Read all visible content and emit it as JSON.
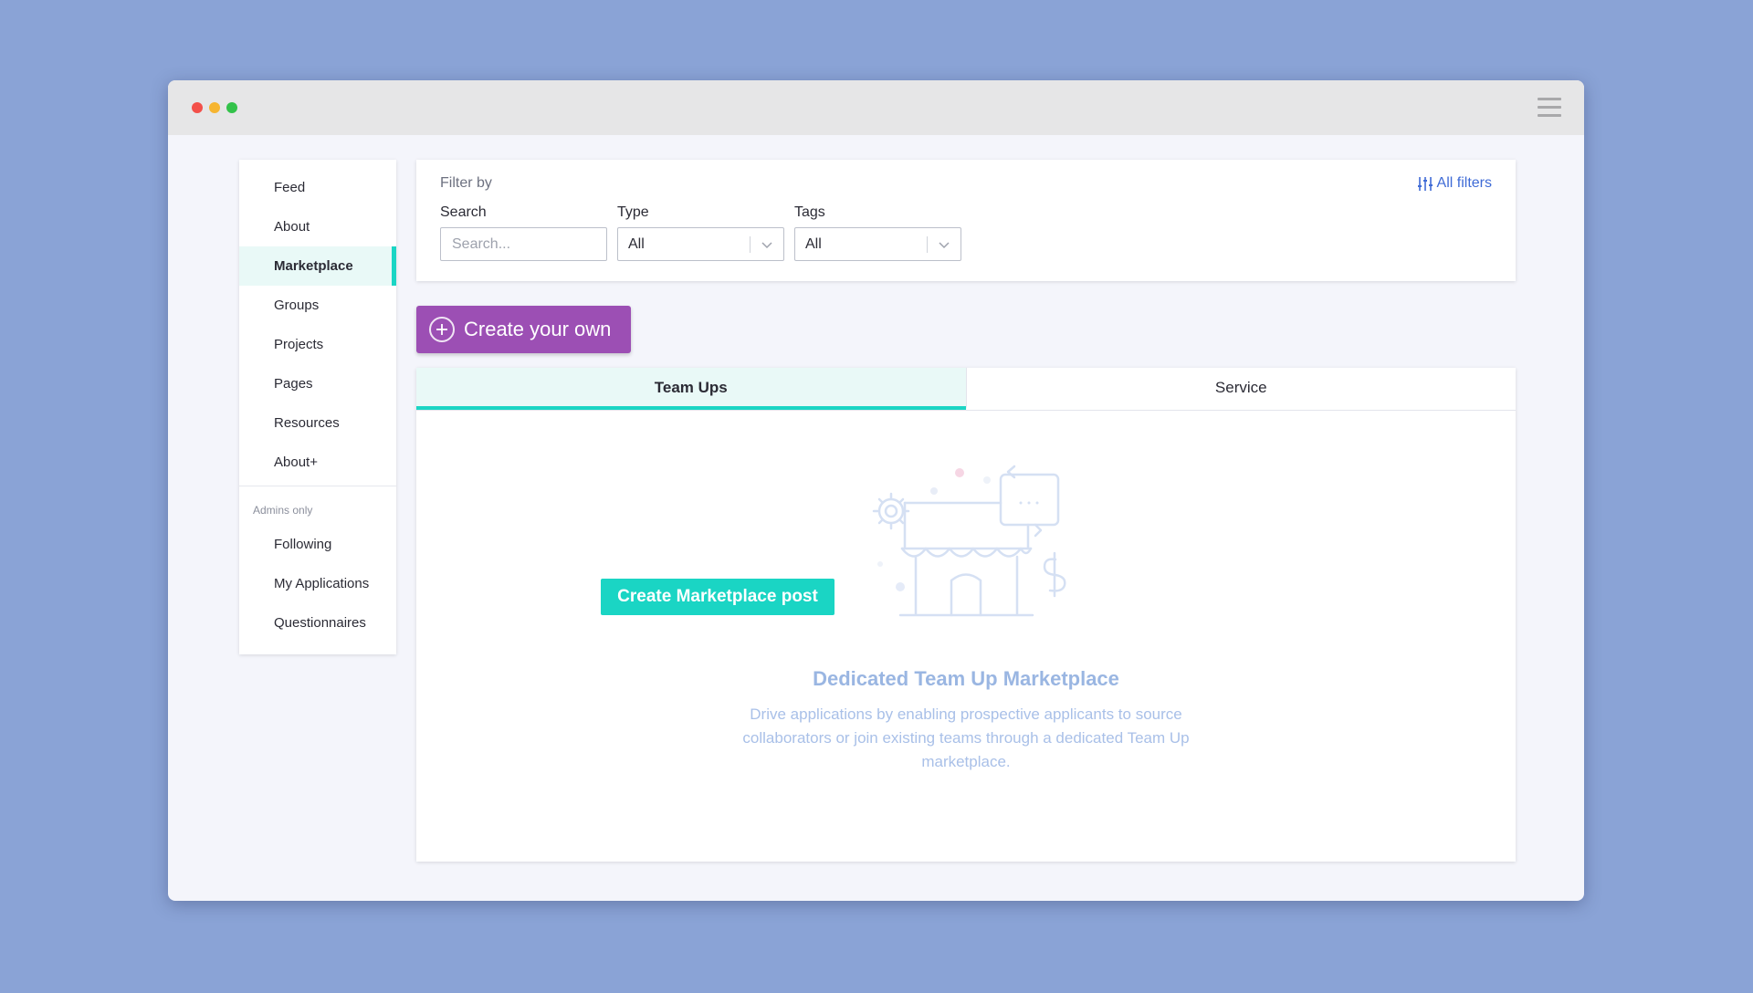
{
  "window": {
    "controls": [
      "close",
      "minimize",
      "maximize"
    ],
    "menu_icon": "hamburger-menu-icon"
  },
  "sidebar": {
    "items": [
      {
        "label": "Feed"
      },
      {
        "label": "About"
      },
      {
        "label": "Marketplace",
        "active": true
      },
      {
        "label": "Groups"
      },
      {
        "label": "Projects"
      },
      {
        "label": "Pages"
      },
      {
        "label": "Resources"
      },
      {
        "label": "About+"
      }
    ],
    "admins_label": "Admins only",
    "admin_items": [
      {
        "label": "Following"
      },
      {
        "label": "My Applications"
      },
      {
        "label": "Questionnaires"
      }
    ]
  },
  "filters": {
    "title": "Filter by",
    "all_filters_label": "All filters",
    "all_filters_icon": "sliders-icon",
    "search": {
      "label": "Search",
      "placeholder": "Search...",
      "value": ""
    },
    "type": {
      "label": "Type",
      "value": "All"
    },
    "tags": {
      "label": "Tags",
      "value": "All"
    }
  },
  "create_button": {
    "label": "Create your own",
    "icon": "plus-circle-icon"
  },
  "tabs": [
    {
      "label": "Team Ups",
      "active": true
    },
    {
      "label": "Service"
    }
  ],
  "empty_state": {
    "illustration": "marketplace-storefront-icon",
    "title": "Dedicated Team Up Marketplace",
    "description": "Drive applications by enabling prospective applicants to source collaborators or join existing teams through a dedicated Team Up marketplace.",
    "cta_label": "Create Marketplace post"
  },
  "colors": {
    "background": "#8aa3d6",
    "accent_teal": "#1ad5c4",
    "create_purple": "#9c4fb4",
    "link_blue": "#3f6bd6",
    "empty_text": "#9ab6e2"
  }
}
